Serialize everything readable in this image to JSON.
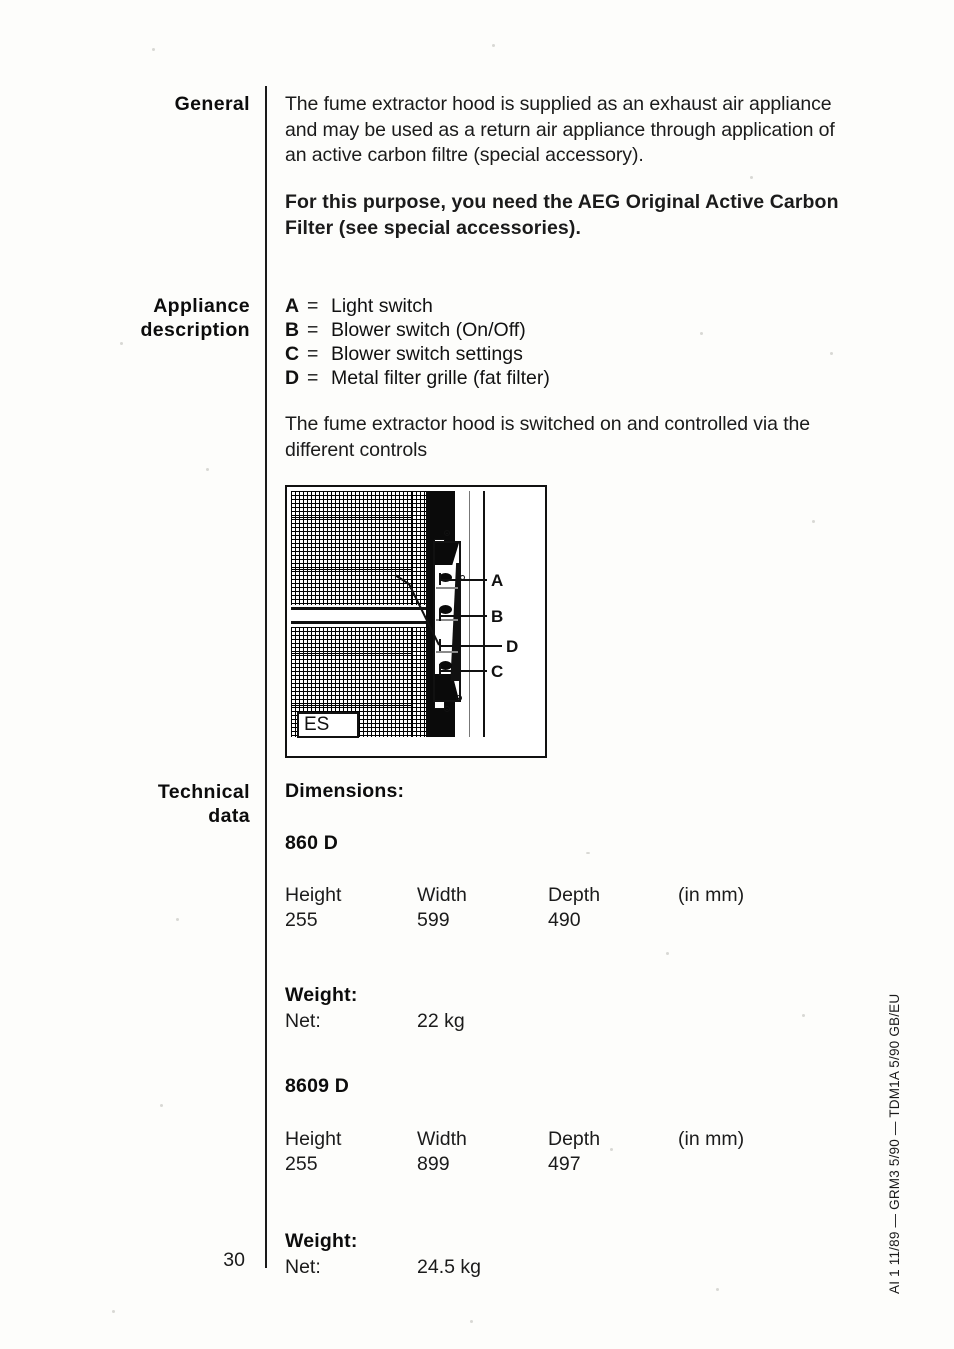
{
  "page": {
    "number": "30",
    "margin_code": "AI 1 11/89 — GRM3 5/90 — TDM1A 5/90   GB/EU"
  },
  "sections": {
    "general": {
      "label": "General",
      "paragraph": "The fume extractor hood is supplied as an exhaust air appliance and may be used as a return air appliance through application of an active carbon filtre (special accessory).",
      "bold_paragraph": "For this purpose, you need the AEG Original Active Carbon Filter (see special accessories)."
    },
    "appliance_description": {
      "label_line1": "Appliance",
      "label_line2": "description",
      "items": [
        {
          "key": "A",
          "eq": "=",
          "value": "Light switch"
        },
        {
          "key": "B",
          "eq": "=",
          "value": "Blower switch (On/Off)"
        },
        {
          "key": "C",
          "eq": "=",
          "value": "Blower switch settings"
        },
        {
          "key": "D",
          "eq": "=",
          "value": "Metal filter grille (fat filter)"
        }
      ],
      "paragraph": "The fume extractor hood is switched on and controlled via the different controls"
    },
    "figure": {
      "badge": "ES",
      "callouts": [
        {
          "id": "A"
        },
        {
          "id": "B"
        },
        {
          "id": "D"
        },
        {
          "id": "C"
        }
      ]
    },
    "technical_data": {
      "label_line1": "Technical",
      "label_line2": "data",
      "dimensions_heading": "Dimensions:",
      "models": [
        {
          "name": "860 D",
          "headers": [
            "Height",
            "Width",
            "Depth",
            "(in mm)"
          ],
          "values": [
            "255",
            "599",
            "490",
            ""
          ],
          "weight_heading": "Weight:",
          "weight_label": "Net:",
          "weight_value": "22 kg"
        },
        {
          "name": "8609 D",
          "headers": [
            "Height",
            "Width",
            "Depth",
            "(in mm)"
          ],
          "values": [
            "255",
            "899",
            "497",
            ""
          ],
          "weight_heading": "Weight:",
          "weight_label": "Net:",
          "weight_value": "24.5 kg"
        }
      ]
    }
  }
}
